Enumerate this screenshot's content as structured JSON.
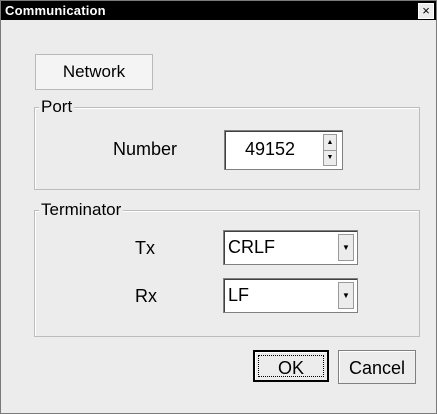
{
  "window": {
    "title": "Communication",
    "close_glyph": "×"
  },
  "tabs": [
    {
      "label": "Network"
    }
  ],
  "port": {
    "group_label": "Port",
    "number_label": "Number",
    "number_value": "49152",
    "spin_up_glyph": "▲",
    "spin_down_glyph": "▼"
  },
  "terminator": {
    "group_label": "Terminator",
    "tx_label": "Tx",
    "tx_value": "CRLF",
    "rx_label": "Rx",
    "rx_value": "LF",
    "dropdown_glyph": "▼"
  },
  "buttons": {
    "ok_label": "OK",
    "cancel_label": "Cancel"
  },
  "colors": {
    "titlebar": "#000000",
    "dialog_bg": "#ececec"
  }
}
